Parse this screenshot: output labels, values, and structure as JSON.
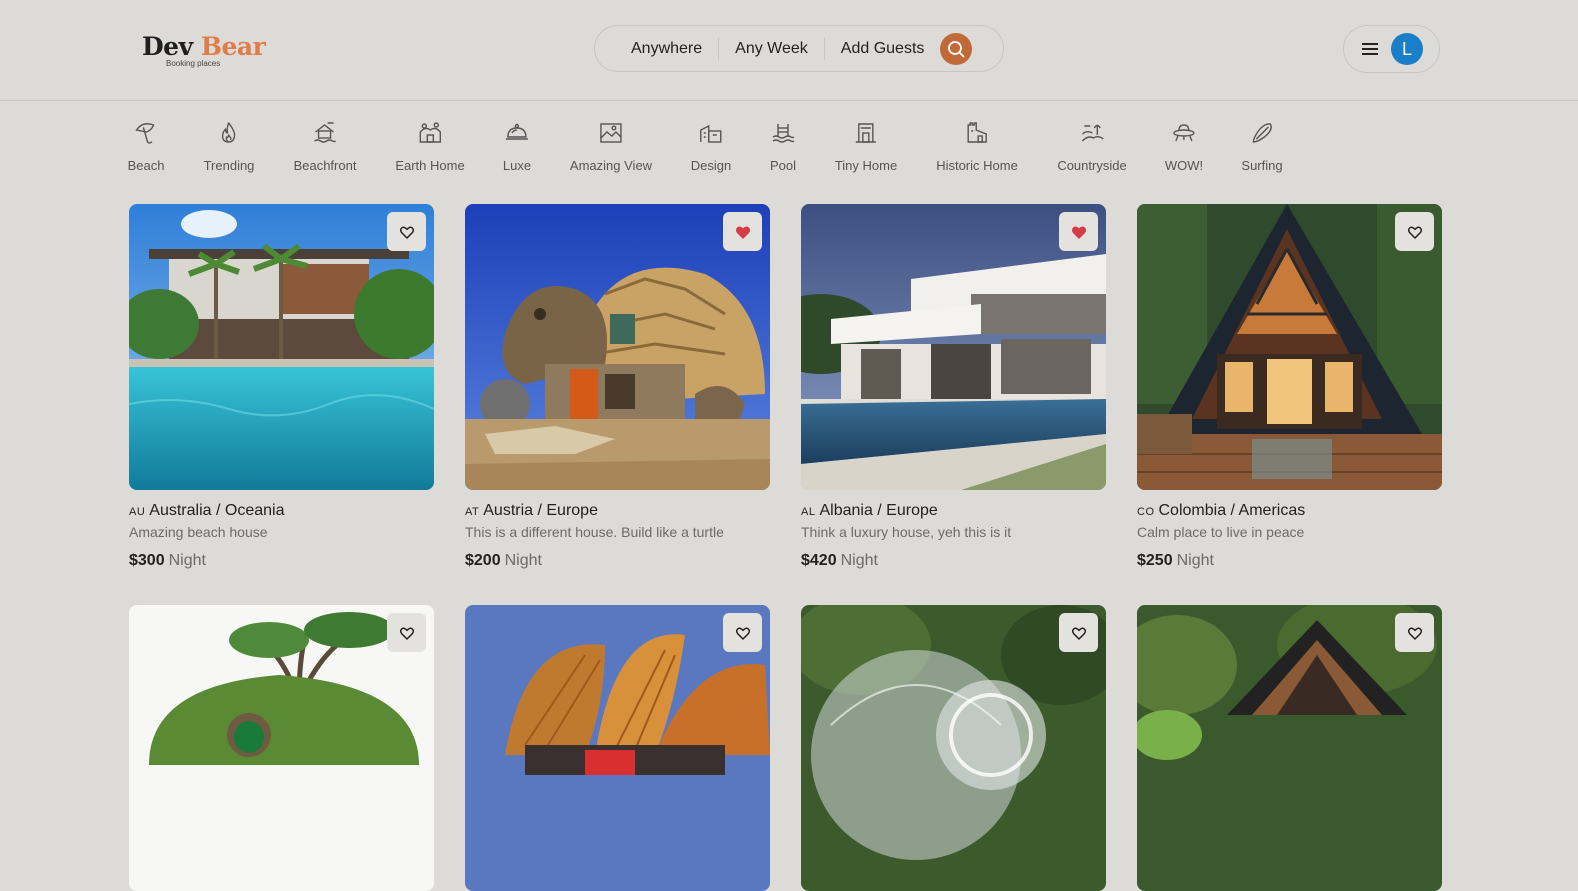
{
  "brand": {
    "name_part1": "Dev",
    "name_part2": "Bear",
    "tagline": "Booking places",
    "accent_color": "#e07c48"
  },
  "search": {
    "where": "Anywhere",
    "when": "Any Week",
    "guests": "Add Guests",
    "button_color": "#c2693a"
  },
  "user": {
    "avatar_initial": "L",
    "avatar_color": "#1a7ec8"
  },
  "categories": [
    {
      "label": "Beach",
      "icon": "umbrella-icon"
    },
    {
      "label": "Trending",
      "icon": "flame-icon"
    },
    {
      "label": "Beachfront",
      "icon": "beachfront-icon"
    },
    {
      "label": "Earth Home",
      "icon": "earth-home-icon"
    },
    {
      "label": "Luxe",
      "icon": "cloche-icon"
    },
    {
      "label": "Amazing View",
      "icon": "landscape-icon"
    },
    {
      "label": "Design",
      "icon": "building-icon"
    },
    {
      "label": "Pool",
      "icon": "pool-icon"
    },
    {
      "label": "Tiny Home",
      "icon": "tiny-home-icon"
    },
    {
      "label": "Historic Home",
      "icon": "castle-icon"
    },
    {
      "label": "Countryside",
      "icon": "countryside-icon"
    },
    {
      "label": "WOW!",
      "icon": "ufo-icon"
    },
    {
      "label": "Surfing",
      "icon": "surfboard-icon"
    }
  ],
  "listings": [
    {
      "country_code": "AU",
      "location": "Australia / Oceania",
      "description": "Amazing beach house",
      "price": "$300",
      "unit": "Night",
      "favorited": false
    },
    {
      "country_code": "AT",
      "location": "Austria / Europe",
      "description": "This is a different house. Build like a turtle",
      "price": "$200",
      "unit": "Night",
      "favorited": true
    },
    {
      "country_code": "AL",
      "location": "Albania / Europe",
      "description": "Think a luxury house, yeh this is it",
      "price": "$420",
      "unit": "Night",
      "favorited": true
    },
    {
      "country_code": "CO",
      "location": "Colombia / Americas",
      "description": "Calm place to live in peace",
      "price": "$250",
      "unit": "Night",
      "favorited": false
    },
    {
      "favorited": false
    },
    {
      "favorited": false
    },
    {
      "favorited": false
    },
    {
      "favorited": false
    }
  ],
  "colors": {
    "favorite_active": "#d63c48",
    "background": "#dddbd8"
  }
}
